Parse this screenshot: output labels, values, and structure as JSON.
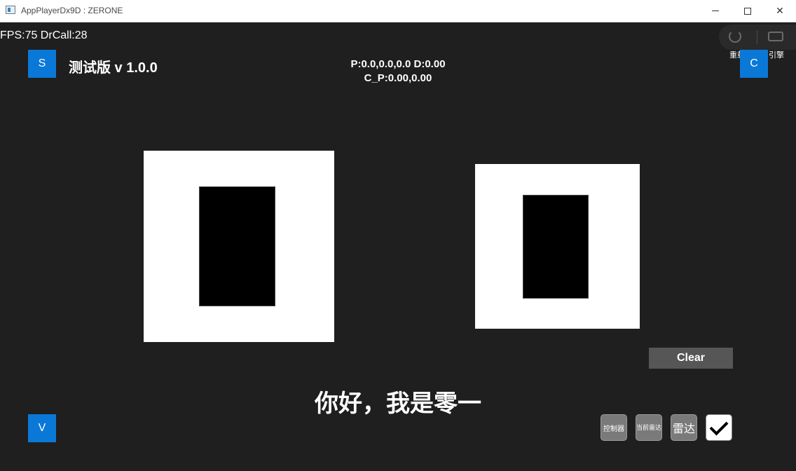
{
  "window": {
    "title": "AppPlayerDx9D : ZERONE",
    "icon": "app-window-icon",
    "controls": [
      "minimize",
      "maximize",
      "close"
    ]
  },
  "hud": {
    "fps": "FPS:75 DrCall:28",
    "version": "测试版 v 1.0.0",
    "position": "P:0.0,0.0,0.0 D:0.00",
    "camera_position": "C_P:0.00,0.00"
  },
  "buttons": {
    "s": "S",
    "c": "C",
    "v": "V",
    "clear": "Clear",
    "reload": "重载",
    "engine": "引擎"
  },
  "greeting": "你好，我是零一",
  "toolbar": {
    "controller": "控制器",
    "current_radar": "当前雷达",
    "radar": "雷达",
    "confirm_icon": "checkmark-icon"
  },
  "colors": {
    "accent": "#0a78d7",
    "background": "#1f1f1f",
    "panel": "#ffffff",
    "clear_button": "#565656",
    "tool_button": "#7a7a7a"
  }
}
